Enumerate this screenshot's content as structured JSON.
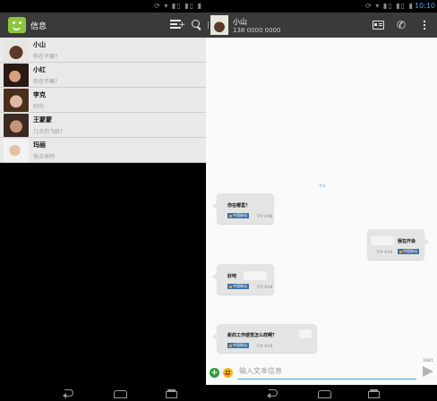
{
  "left_pane": {
    "status_icons": "⟳ ▾ ▮▯ ▮▯ ▮",
    "app_title": "信息",
    "conversations": [
      {
        "name": "小山",
        "snippet": "你在干嘛?"
      },
      {
        "name": "小红",
        "snippet": "你在干嘛?"
      },
      {
        "name": "李克",
        "snippet": "好的"
      },
      {
        "name": "王蒙蒙",
        "snippet": "几点的飞机?"
      },
      {
        "name": "玛丽",
        "snippet": "快点来吧"
      }
    ]
  },
  "right_pane": {
    "status_icons": "⟳ ▾ ▮▯ ▮▯ ▮ ",
    "clock": "10:10",
    "contact": {
      "name": "小山",
      "number": "138 0000 0000"
    },
    "thread": {
      "date_separator": "今天",
      "messages": [
        {
          "direction": "in",
          "text": "你在哪里？",
          "carrier": "中国移动",
          "time": "下午 4:04"
        },
        {
          "direction": "out",
          "text": "我在开会",
          "carrier": "中国移动",
          "time": "下午 4:04"
        },
        {
          "direction": "in",
          "text": "好吧",
          "carrier": "中国移动",
          "time": "下午 4:04"
        },
        {
          "direction": "in",
          "text": "新的工作感觉怎么样啊？",
          "carrier": "中国移动",
          "time": "下午 4:04"
        }
      ]
    },
    "composer": {
      "placeholder": "输入文本信息",
      "char_count": "160/1"
    }
  },
  "colors": {
    "accent": "#3fa9f5",
    "action_bar": "#3a3a3a",
    "list_bg": "#e9e9e9",
    "bubble": "#e4e4e4",
    "app_icon": "#8cc63f"
  },
  "icons": {
    "app": "messaging-smiley-icon",
    "compose": "new-message-icon",
    "search": "search-icon",
    "contact_card": "contact-card-icon",
    "call": "phone-icon",
    "overflow": "overflow-menu-icon",
    "attach": "add-attachment-icon",
    "emoji": "emoji-icon",
    "send": "send-icon",
    "nav": [
      "back-icon",
      "home-icon",
      "recent-apps-icon"
    ]
  }
}
